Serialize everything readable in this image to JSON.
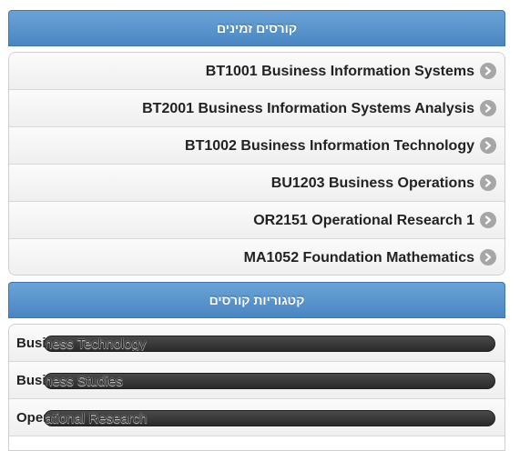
{
  "available_courses": {
    "title": "קורסים זמינים",
    "items": [
      "BT1001 Business Information Systems",
      "BT2001 Business Information Systems Analysis",
      "BT1002 Business Information Technology",
      "BU1203 Business Operations",
      "OR2151 Operational Research 1",
      "MA1052 Foundation Mathematics"
    ]
  },
  "course_categories": {
    "title": "קטגוריות קורסים",
    "items": [
      {
        "label": "Business Technology",
        "visible_prefix": "Busi",
        "overlay": "ness Technology"
      },
      {
        "label": "Business Studies",
        "visible_prefix": "Busi",
        "overlay": "ness Studies"
      },
      {
        "label": "Operational Research",
        "visible_prefix": "Oper",
        "overlay": "ational Research"
      }
    ]
  },
  "icons": {
    "row_chevron": "chevron-right-circle-icon"
  },
  "colors": {
    "header_bar": "#5a95cc",
    "chevron": "#a6a6a6",
    "pill": "#333333"
  }
}
